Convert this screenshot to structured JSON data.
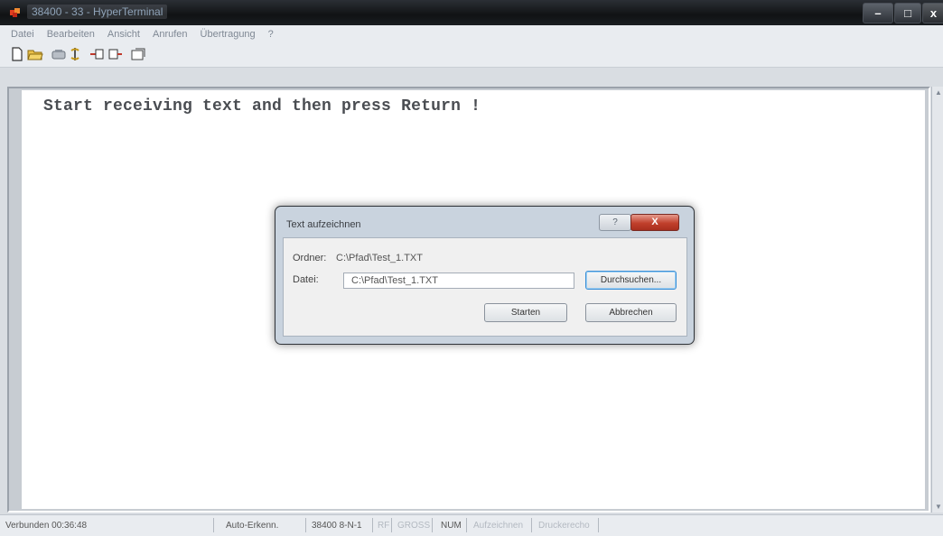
{
  "window": {
    "title": "38400 - 33 - HyperTerminal",
    "controls": {
      "minimize": "–",
      "maximize": "□",
      "close": "x"
    }
  },
  "menu": [
    "Datei",
    "Bearbeiten",
    "Ansicht",
    "Anrufen",
    "Übertragung",
    "?"
  ],
  "toolbar": [
    "new-document-icon",
    "open-folder-icon",
    "phone-icon",
    "disconnect-icon",
    "send-icon",
    "receive-icon",
    "properties-icon"
  ],
  "terminal": {
    "text": "Start receiving text and then press Return !"
  },
  "dialog": {
    "title": "Text aufzeichnen",
    "help_label": "?",
    "close_label": "X",
    "folder_label": "Ordner:",
    "folder_value": "C:\\Pfad\\Test_1.TXT",
    "file_label": "Datei:",
    "file_value": "C:\\Pfad\\Test_1.TXT",
    "browse_label": "Durchsuchen...",
    "start_label": "Starten",
    "cancel_label": "Abbrechen"
  },
  "status": {
    "connected": "Verbunden 00:36:48",
    "detection": "Auto-Erkenn.",
    "settings": "38400 8-N-1",
    "rf": "RF",
    "caps": "GROSS",
    "num": "NUM",
    "capture": "Aufzeichnen",
    "echo": "Druckerecho"
  }
}
